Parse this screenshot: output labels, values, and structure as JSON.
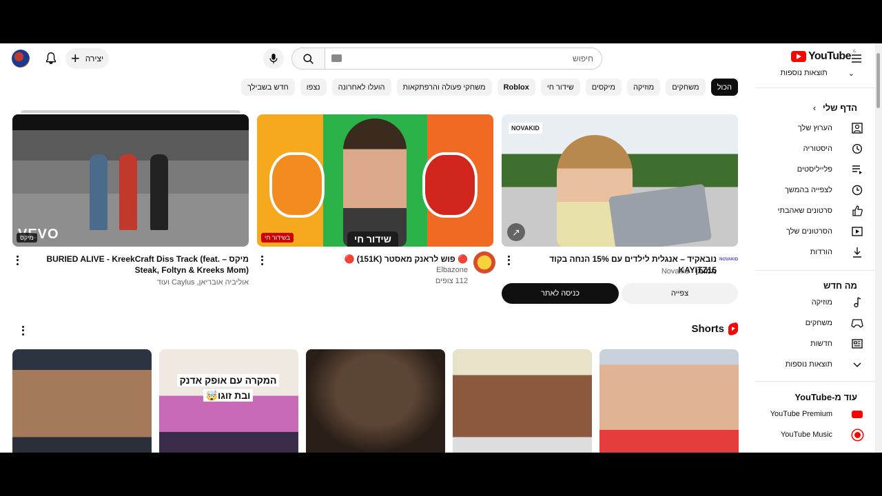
{
  "header": {
    "create_label": "יצירה",
    "search_placeholder": "חיפוש",
    "logo_text": "YouTube",
    "logo_country": "IL"
  },
  "chips": [
    {
      "label": "הכול",
      "active": true
    },
    {
      "label": "משחקים"
    },
    {
      "label": "מוזיקה"
    },
    {
      "label": "מיקסים"
    },
    {
      "label": "שידור חי"
    },
    {
      "label": "Roblox"
    },
    {
      "label": "משחקי פעולה והרפתקאות"
    },
    {
      "label": "הועלו לאחרונה"
    },
    {
      "label": "נצפו"
    },
    {
      "label": "חדש בשבילך"
    }
  ],
  "sidebar": {
    "top_more": "תוצאות נוספות",
    "you_title": "הדף שלי",
    "you_items": [
      {
        "label": "הערוץ שלך",
        "icon": "channel-icon"
      },
      {
        "label": "היסטוריה",
        "icon": "history-icon"
      },
      {
        "label": "פלייליסטים",
        "icon": "playlists-icon"
      },
      {
        "label": "לצפייה בהמשך",
        "icon": "watch-later-icon"
      },
      {
        "label": "סרטונים שאהבתי",
        "icon": "like-icon"
      },
      {
        "label": "הסרטונים שלך",
        "icon": "your-videos-icon"
      },
      {
        "label": "הורדות",
        "icon": "download-icon"
      }
    ],
    "explore_title": "מה חדש",
    "explore_items": [
      {
        "label": "מוזיקה",
        "icon": "music-icon"
      },
      {
        "label": "משחקים",
        "icon": "gaming-icon"
      },
      {
        "label": "חדשות",
        "icon": "news-icon"
      },
      {
        "label": "תוצאות נוספות",
        "icon": "chevron-down-icon"
      }
    ],
    "more_title": "עוד מ-YouTube",
    "more_items": [
      {
        "label": "YouTube Premium",
        "icon": "youtube-premium-icon"
      },
      {
        "label": "YouTube Music",
        "icon": "youtube-music-icon"
      }
    ]
  },
  "videos": [
    {
      "title": "מיקס – BURIED ALIVE - KreekCraft Diss Track (feat. Steak, Foltyn & Kreeks Mom)",
      "meta1": "אוליביה אובריאן, Caylus ועוד",
      "brand": "vevo",
      "badge": "מיקס"
    },
    {
      "title": "🔴 פוש לראנק מאסטר (151K) 🔴",
      "channel": "Elbazone",
      "views": "112 צופים",
      "live_text": "שידור חי",
      "badge": "בשידור חי"
    },
    {
      "title": "נובאקיד – אנגלית לילדים עם 15% הנחה בקוד KAYITZ15",
      "sponsored": "ממומן",
      "channel": "Novakid",
      "brand": "NOVAKID",
      "btn_primary": "כניסה לאתר",
      "btn_secondary": "צפייה"
    }
  ],
  "shorts": {
    "title": "Shorts",
    "short2_caption_l1": "המקרה עם אופק אדנק",
    "short2_caption_l2": "ובת זוגו🤯"
  },
  "colors": {
    "accent": "#ff0000",
    "chip_active": "#0f0f0f"
  }
}
